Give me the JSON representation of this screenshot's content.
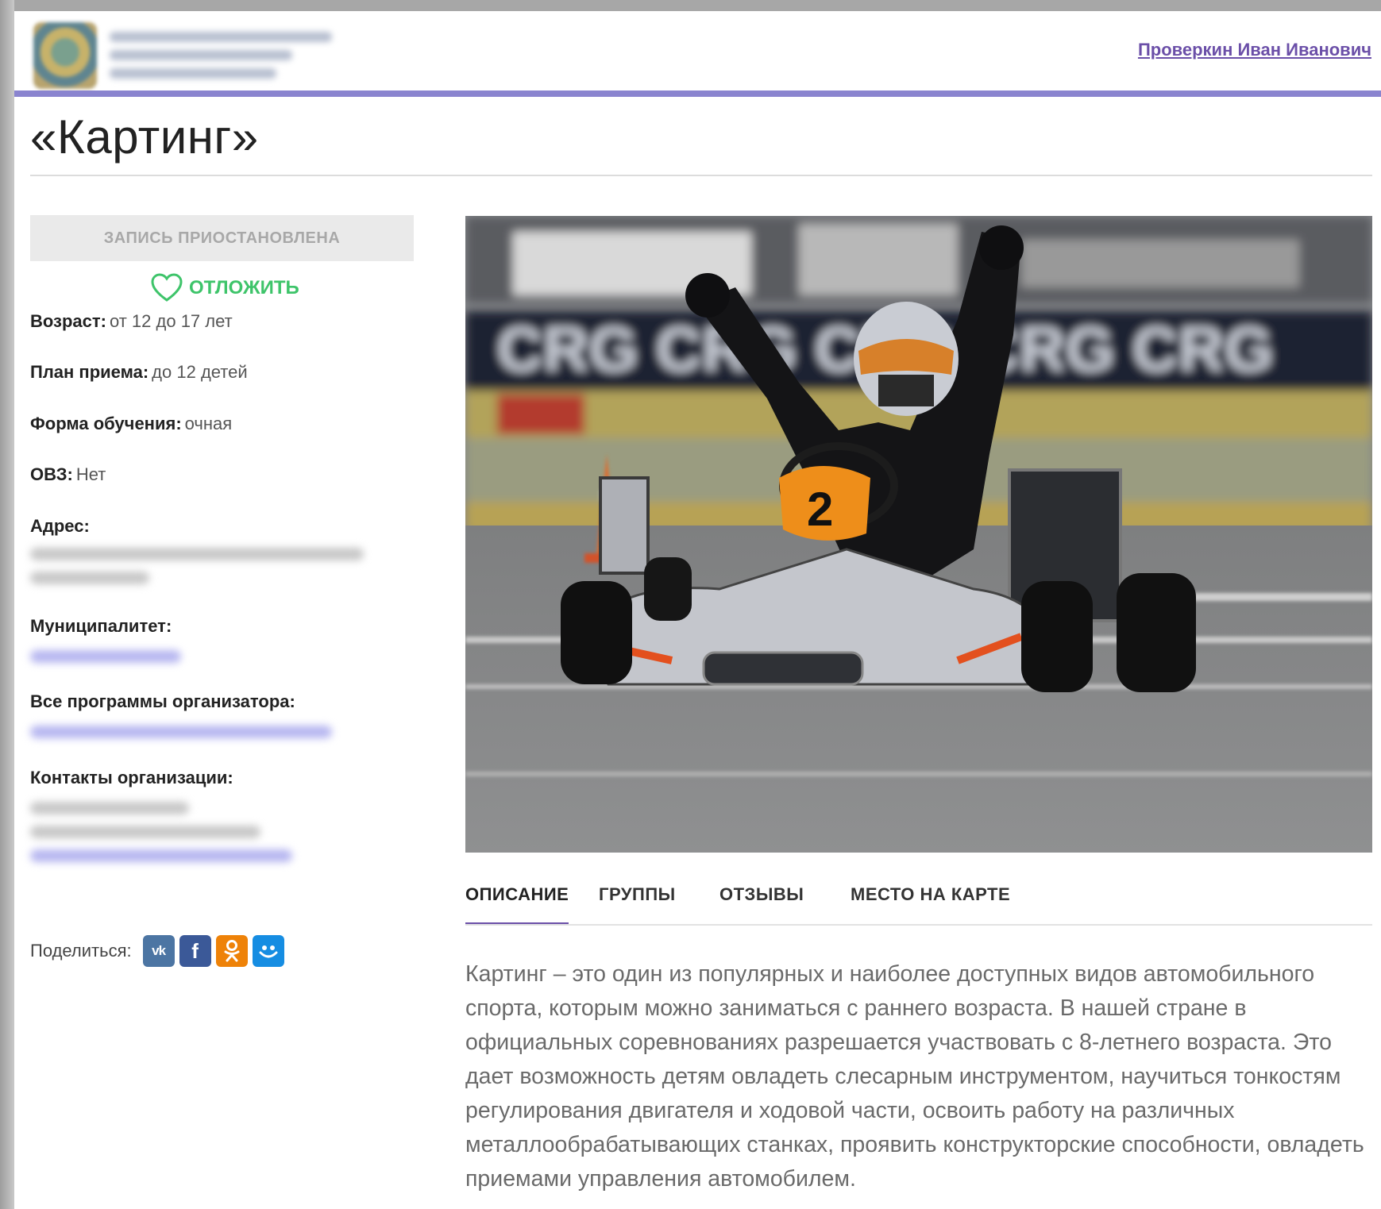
{
  "header": {
    "user_name": "Проверкин Иван Иванович"
  },
  "program": {
    "title": "«Картинг»",
    "enroll_status_button": "ЗАПИСЬ ПРИОСТАНОВЛЕНА",
    "postpone_label": "ОТЛОЖИТЬ"
  },
  "info": {
    "age_label": "Возраст:",
    "age_value": "от 12 до 17 лет",
    "plan_label": "План приема:",
    "plan_value": "до 12 детей",
    "form_label": "Форма обучения:",
    "form_value": "очная",
    "ovz_label": "ОВЗ:",
    "ovz_value": "Нет",
    "address_label": "Адрес:",
    "municipality_label": "Муниципалитет:",
    "all_programs_label": "Все программы организатора:",
    "contacts_label": "Контакты организации:"
  },
  "share": {
    "label": "Поделиться:",
    "networks": [
      "vk-icon",
      "facebook-icon",
      "odnoklassniki-icon",
      "moimir-icon"
    ],
    "colors": {
      "vk": "#4c75a3",
      "facebook": "#3b5998",
      "odnoklassniki": "#ee8208",
      "moimir": "#168de2"
    }
  },
  "tabs": [
    {
      "label": "ОПИСАНИЕ",
      "active": true
    },
    {
      "label": "ГРУППЫ",
      "active": false
    },
    {
      "label": "ОТЗЫВЫ",
      "active": false
    },
    {
      "label": "МЕСТО НА КАРТЕ",
      "active": false
    }
  ],
  "description": "Картинг – это один из популярных и наиболее доступных видов автомобильного спорта, которым можно заниматься с раннего возраста. В нашей стране в официальных соревнованиях разрешается участвовать с 8-летнего возраста. Это дает возможность детям овладеть слесарным инструментом, научиться тонкостям регулирования двигателя и ходовой части, освоить работу на различных металлообрабатывающих станках, проявить конструкторские способности, овладеть приемами управления автомобилем.",
  "hero": {
    "kart_number": "2"
  },
  "colors": {
    "accent": "#6b4fa8",
    "header_bar": "#8a84cf",
    "postpone_green": "#3ec46a"
  }
}
